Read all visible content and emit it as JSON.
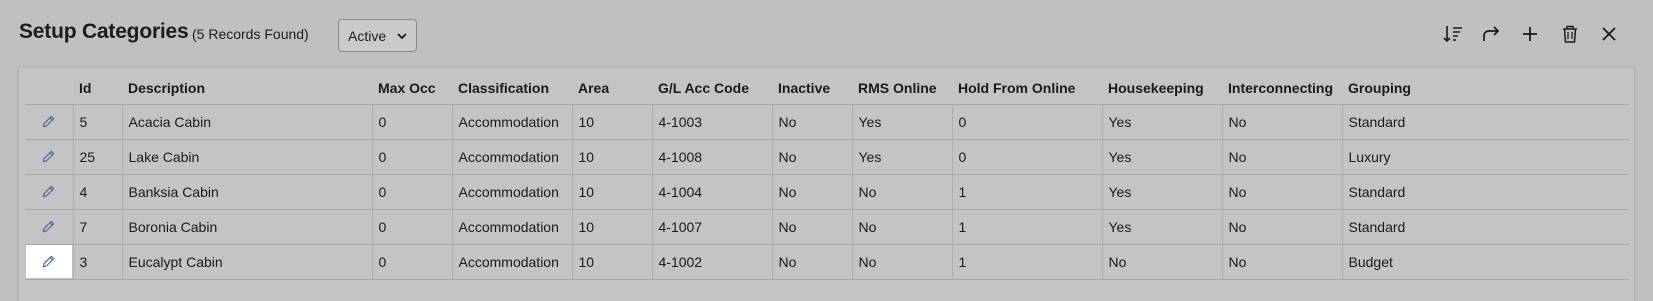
{
  "header": {
    "title": "Setup Categories",
    "record_count": "(5 Records Found)",
    "status_filter": {
      "selected": "Active"
    }
  },
  "toolbar": {
    "buttons": [
      {
        "name": "sort-icon"
      },
      {
        "name": "share-icon"
      },
      {
        "name": "add-icon"
      },
      {
        "name": "trash-icon"
      },
      {
        "name": "close-icon"
      }
    ]
  },
  "table": {
    "columns": [
      "",
      "Id",
      "Description",
      "Max Occ",
      "Classification",
      "Area",
      "G/L Acc Code",
      "Inactive",
      "RMS Online",
      "Hold From Online",
      "Housekeeping",
      "Interconnecting",
      "Grouping"
    ],
    "rows": [
      {
        "id": "5",
        "description": "Acacia Cabin",
        "max_occ": "0",
        "classification": "Accommodation",
        "area": "10",
        "gl_acc_code": "4-1003",
        "inactive": "No",
        "rms_online": "Yes",
        "hold_from_online": "0",
        "housekeeping": "Yes",
        "interconnecting": "No",
        "grouping": "Standard"
      },
      {
        "id": "25",
        "description": "Lake Cabin",
        "max_occ": "0",
        "classification": "Accommodation",
        "area": "10",
        "gl_acc_code": "4-1008",
        "inactive": "No",
        "rms_online": "Yes",
        "hold_from_online": "0",
        "housekeeping": "Yes",
        "interconnecting": "No",
        "grouping": "Luxury"
      },
      {
        "id": "4",
        "description": "Banksia Cabin",
        "max_occ": "0",
        "classification": "Accommodation",
        "area": "10",
        "gl_acc_code": "4-1004",
        "inactive": "No",
        "rms_online": "No",
        "hold_from_online": "1",
        "housekeeping": "Yes",
        "interconnecting": "No",
        "grouping": "Standard"
      },
      {
        "id": "7",
        "description": "Boronia Cabin",
        "max_occ": "0",
        "classification": "Accommodation",
        "area": "10",
        "gl_acc_code": "4-1007",
        "inactive": "No",
        "rms_online": "No",
        "hold_from_online": "1",
        "housekeeping": "Yes",
        "interconnecting": "No",
        "grouping": "Standard"
      },
      {
        "id": "3",
        "description": "Eucalypt Cabin",
        "max_occ": "0",
        "classification": "Accommodation",
        "area": "10",
        "gl_acc_code": "4-1002",
        "inactive": "No",
        "rms_online": "No",
        "hold_from_online": "1",
        "housekeeping": "No",
        "interconnecting": "No",
        "grouping": "Budget"
      }
    ]
  },
  "colors": {
    "background": "#c0c0c0",
    "edit_icon": "#4a6d9a",
    "highlight": "#ffffff"
  }
}
